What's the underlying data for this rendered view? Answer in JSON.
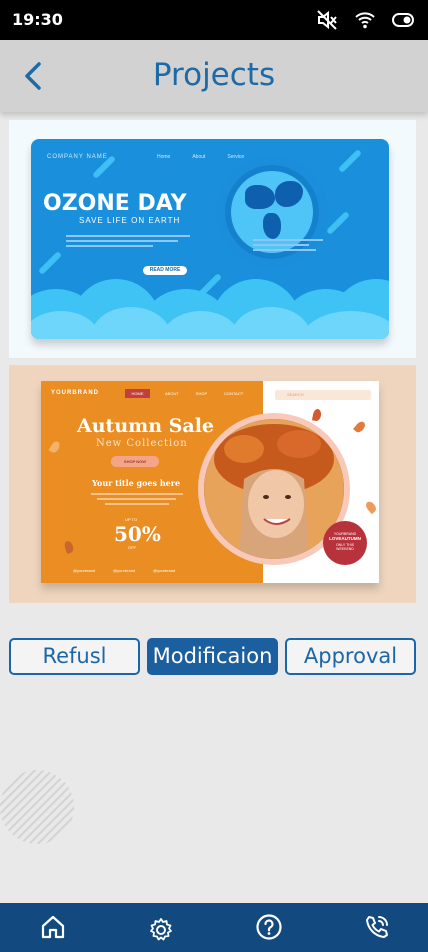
{
  "status_bar": {
    "time": "19:30",
    "icons": [
      "mute-icon",
      "wifi-icon",
      "toggle-icon"
    ]
  },
  "header": {
    "title": "Projects",
    "back_icon": "chevron-left-icon"
  },
  "projects": [
    {
      "company": "COMPANY NAME",
      "nav": [
        "Home",
        "About",
        "Service"
      ],
      "title": "OZONE DAY",
      "subtitle": "SAVE LIFE ON EARTH",
      "button": "READ MORE"
    },
    {
      "brand": "YOURBRAND",
      "nav": [
        "HOME",
        "ABOUT",
        "SHOP",
        "CONTACT"
      ],
      "search": "SEARCH",
      "title": "Autumn Sale",
      "subtitle": "New Collection",
      "button": "SHOP NOW",
      "tagline": "Your title goes here",
      "upto": "UP TO",
      "discount": "50%",
      "off": "OFF",
      "social": [
        "@yourbrand",
        "@yourbrand",
        "@yourbrand"
      ],
      "badge": [
        "YOURBRAND",
        "LOVEAUTUMN",
        "ONLY THIS",
        "WEEKEND"
      ]
    }
  ],
  "actions": {
    "refuse": "Refusl",
    "modify": "Modificaion",
    "approve": "Approval"
  },
  "bottom_nav": [
    "home-icon",
    "settings-icon",
    "help-icon",
    "phone-icon"
  ],
  "colors": {
    "primary": "#1c66a8",
    "nav_bg": "#124a80",
    "header_bg": "#d2d2d2"
  }
}
